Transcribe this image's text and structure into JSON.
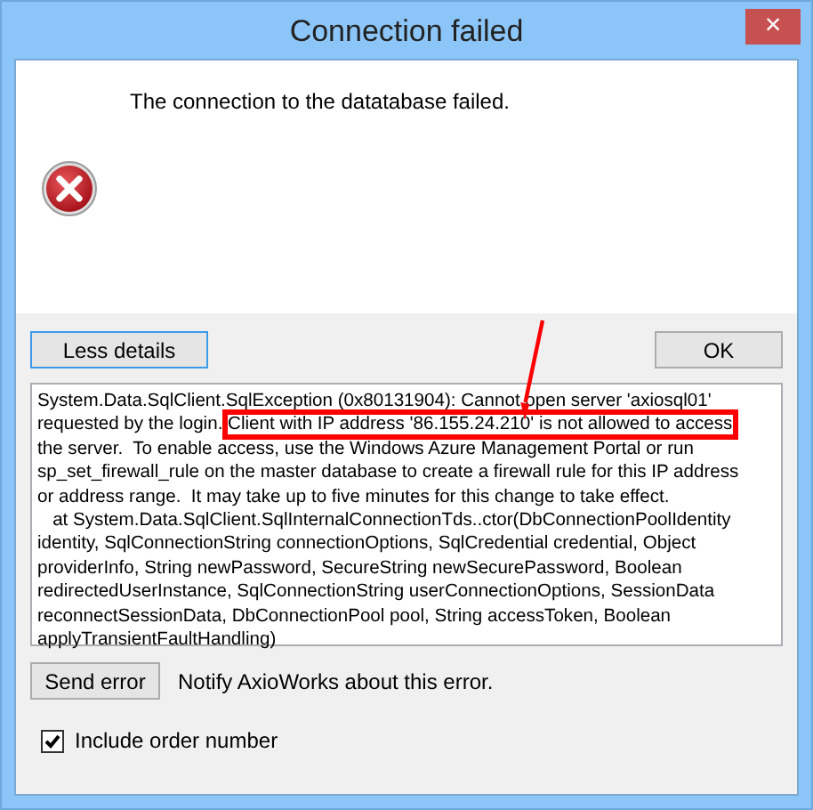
{
  "window": {
    "title": "Connection failed",
    "close": "×"
  },
  "message": "The connection to the datatabase failed.",
  "buttons": {
    "details": "Less details",
    "ok": "OK"
  },
  "details": {
    "lines": [
      {
        "segments": [
          {
            "text": "System.Data.SqlClient.SqlException (0x80131904): Cannot open server 'axiosql01'",
            "highlighted": false
          }
        ]
      },
      {
        "segments": [
          {
            "text": "requested by the login. ",
            "highlighted": false
          },
          {
            "text": "Client with IP address '86.155.24.210' is not allowed to access",
            "highlighted": true
          }
        ]
      },
      {
        "segments": [
          {
            "text": "the server.  To enable access, use the Windows Azure Management Portal or run",
            "highlighted": false
          }
        ]
      },
      {
        "segments": [
          {
            "text": "sp_set_firewall_rule on the master database to create a firewall rule for this IP address",
            "highlighted": false
          }
        ]
      },
      {
        "segments": [
          {
            "text": "or address range.  It may take up to five minutes for this change to take effect.",
            "highlighted": false
          }
        ]
      },
      {
        "segments": [
          {
            "text": "   at System.Data.SqlClient.SqlInternalConnectionTds..ctor(DbConnectionPoolIdentity",
            "highlighted": false
          }
        ]
      },
      {
        "segments": [
          {
            "text": "identity, SqlConnectionString connectionOptions, SqlCredential credential, Object",
            "highlighted": false
          }
        ]
      },
      {
        "segments": [
          {
            "text": "providerInfo, String newPassword, SecureString newSecurePassword, Boolean",
            "highlighted": false
          }
        ]
      },
      {
        "segments": [
          {
            "text": "redirectedUserInstance, SqlConnectionString userConnectionOptions, SessionData",
            "highlighted": false
          }
        ]
      },
      {
        "segments": [
          {
            "text": "reconnectSessionData, DbConnectionPool pool, String accessToken, Boolean",
            "highlighted": false
          }
        ]
      },
      {
        "segments": [
          {
            "text": "applyTransientFaultHandling)",
            "highlighted": false
          }
        ]
      }
    ]
  },
  "send": {
    "button": "Send error",
    "note": "Notify AxioWorks about this error."
  },
  "include_order": {
    "label": "Include order number",
    "checked": true
  }
}
